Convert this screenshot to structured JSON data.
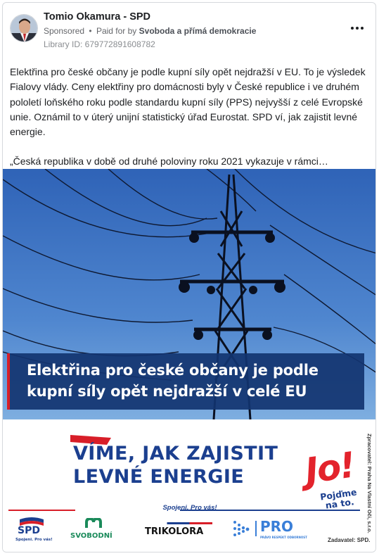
{
  "header": {
    "page_name": "Tomio Okamura - SPD",
    "sponsored": "Sponsored",
    "separator": "•",
    "paid_for_prefix": "Paid for by",
    "payer": "Svoboda a přímá demokracie",
    "library_id": "Library ID: 679772891608782"
  },
  "ad_text": {
    "paragraph": "Elektřina pro české občany je podle kupní síly opět nejdražší v EU. To je výsledek Fialovy vlády. Ceny elektřiny pro domácnosti byly v České republice i ve druhém pololetí loňského roku podle standardu kupní síly (PPS) nejvyšší z celé Evropské unie. Oznámil to v úterý unijní statistický úřad Eurostat. SPD ví, jak zajistit levné energie.",
    "quote": "„Česká republika v době od druhé poloviny roku 2021 vykazuje v rámci…"
  },
  "creative": {
    "headline_line1": "Elektřina pro české občany je podle",
    "headline_line2": "kupní síly opět nejdražší v celé EU",
    "slogan_line1": "VÍME, JAK ZAJISTIT",
    "slogan_line2": "LEVNÉ ENERGIE",
    "jo": "Jo!",
    "jo_sub_line1": "Pojďme",
    "jo_sub_line2": "na to.",
    "side_credit": "Zpracovatel: Praha Na Vlastní Oči, s.r.o.",
    "tagline": "Spojeni. Pro vás!",
    "logos": {
      "spd": "SPD",
      "spd_sub": "Spojeni. Pro vás!",
      "svobodni": "SVOBODNÍ",
      "trikolora": "TRIKOLORA",
      "pro": "PRO",
      "pro_sub": "PRÁVO RESPEKT ODBORNOST"
    },
    "zadavatel": "Zadavatel: SPD.",
    "colors": {
      "brand_blue": "#1b3f8f",
      "brand_red": "#d81e28",
      "headline_band": "#123470"
    }
  },
  "icons": {
    "more": "more-horizontal-icon"
  }
}
